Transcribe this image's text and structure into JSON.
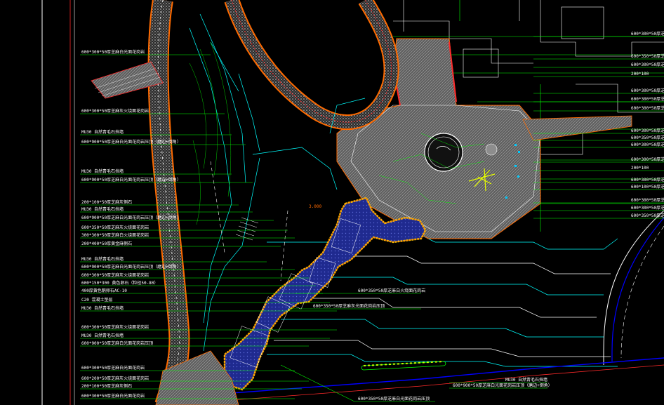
{
  "drawing": {
    "colors": {
      "background": "#000000",
      "leader": "#00ff00",
      "outline": "#00ffff",
      "path_edge": "#ff6a00",
      "paving": "#8c8c8c",
      "water": "#1f2a8f",
      "pebble": "#ffc400",
      "white_line": "#ffffff",
      "road": "#0000ff",
      "red": "#ff2a2a"
    },
    "left_labels": [
      "600*300*50厚芝麻白光面花岗岩",
      "600*300*50厚芝麻灰火烧面花岗岩",
      "MU30 自然青毛石挡墙",
      "600*900*50厚芝麻白光面花岗岩压顶（磨边+倒角）",
      "MU30 自然青毛石挡墙",
      "600*900*50厚芝麻白光面花岗岩压顶（磨边+倒角）",
      "200*100*50厚芝麻灰侧石",
      "MU30 自然青毛石挡墙",
      "600*900*50厚芝麻白光面花岗岩压顶（磨边+倒角）",
      "600*350*50厚芝麻灰火烧面花岗岩",
      "300*300*50厚芝麻白火烧面花岗岩",
      "200*400*50厚黄金麻侧石",
      "MU30 自然青毛石挡墙",
      "600*900*50厚芝麻白光面花岗岩压顶（磨边+倒角）",
      "600*300*50厚芝麻灰火烧面花岗岩",
      "600*150*300 黄色卵石（粒径50-80）",
      "400厚黄色鹅卵石AC-10",
      "C20 混凝土垫层",
      "MU30 自然青毛石挡墙",
      "600*300*50厚芝麻灰火烧面花岗岩",
      "MU30 自然青毛石挡墙",
      "600*900*50厚芝麻白光面花岗岩压顶",
      "600*300*50厚芝麻白光面花岗岩",
      "600*200*50厚芝麻灰火烧面花岗岩",
      "200*100*50厚芝麻灰侧石",
      "600*300*50厚芝麻白光面花岗岩"
    ],
    "right_labels": [
      "600*300*50厚芝麻",
      "600*350*50厚芝麻",
      "600*300*50厚芝麻",
      "200*100",
      "600*300*50厚芝麻",
      "600*300*50厚芝麻",
      "600*300*50厚芝麻",
      "600*300*50厚芝麻",
      "600*350*50厚芝麻",
      "600*300*50厚芝麻",
      "600*300*50厚芝麻",
      "200*100",
      "600*300*50厚芝麻",
      "600*100*50厚芝麻",
      "600*300*50厚芝麻",
      "600*300*50厚芝麻",
      "600*350*50厚芝麻"
    ],
    "center_labels": [
      "600*350*50厚芝麻白火烧面花岗岩",
      "600*350*50厚芝麻灰光面花岗岩压顶"
    ],
    "bottom_labels": [
      "MU30 自然青毛石挡墙",
      "600*900*50厚芝麻白光面花岗岩压顶（磨边+倒角）",
      "600*350*50厚芝麻白光面花岗岩压顶"
    ],
    "elevation_tag": "3.000"
  }
}
